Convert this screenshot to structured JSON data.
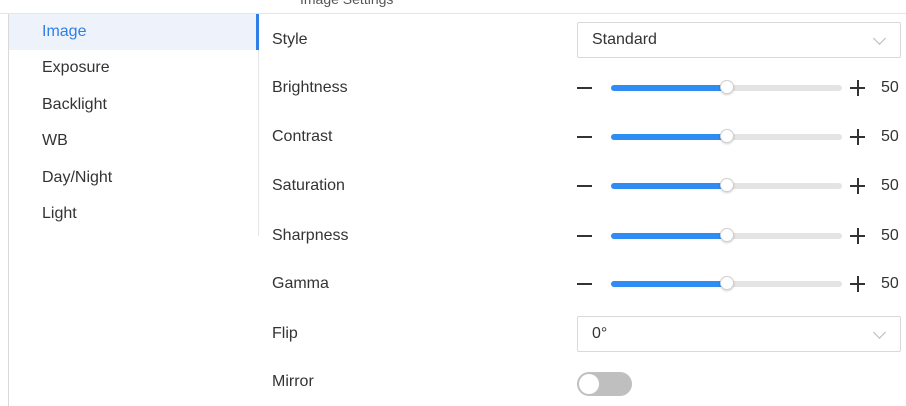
{
  "header": {
    "fragment": "Image Settings"
  },
  "sidebar": {
    "items": [
      {
        "label": "Image",
        "active": true
      },
      {
        "label": "Exposure"
      },
      {
        "label": "Backlight"
      },
      {
        "label": "WB"
      },
      {
        "label": "Day/Night"
      },
      {
        "label": "Light"
      }
    ]
  },
  "settings": {
    "style": {
      "label": "Style",
      "value": "Standard"
    },
    "brightness": {
      "label": "Brightness",
      "value": "50",
      "level": 0.5
    },
    "contrast": {
      "label": "Contrast",
      "value": "50",
      "level": 0.5
    },
    "saturation": {
      "label": "Saturation",
      "value": "50",
      "level": 0.5
    },
    "sharpness": {
      "label": "Sharpness",
      "value": "50",
      "level": 0.5
    },
    "gamma": {
      "label": "Gamma",
      "value": "50",
      "level": 0.5
    },
    "flip": {
      "label": "Flip",
      "value": "0°"
    },
    "mirror": {
      "label": "Mirror",
      "on": false
    }
  },
  "colors": {
    "accent": "#2f8cf2",
    "active_text": "#2f7fe8",
    "active_bg": "#edf2fb",
    "toggle_off": "#bfbfbf"
  },
  "icons": {
    "select_arrow": "chevron-down-icon",
    "decrease": "minus-icon",
    "increase": "plus-icon"
  }
}
